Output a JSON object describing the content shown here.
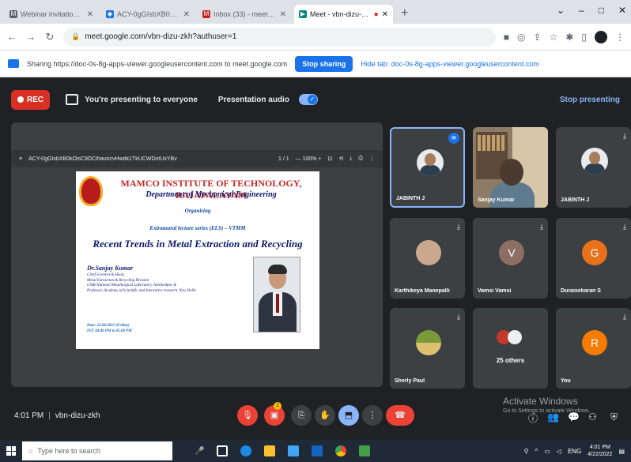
{
  "browser": {
    "tabs": [
      {
        "label": "Webinar invitation for \"Recent T...",
        "favicon_color": "#5f6368",
        "active": false
      },
      {
        "label": "ACY-0gGIsbXB0kOlsC9DCI...",
        "favicon_color": "#1a73e8",
        "active": false
      },
      {
        "label": "Inbox (33) - meetsangita@rdtp...",
        "favicon_color": "#c5221f",
        "active": false
      },
      {
        "label": "Meet - vbn-dizu-zkh",
        "favicon_color": "#00897b",
        "active": true
      }
    ],
    "new_tab": "+",
    "window_controls": [
      "⌄",
      "–",
      "□",
      "✕"
    ],
    "url": "meet.google.com/vbn-dizu-zkh?authuser=1"
  },
  "sharing_bar": {
    "message": "Sharing https://doc-0s-8g-apps-viewer.googleusercontent.com to meet.google.com",
    "stop_label": "Stop sharing",
    "hide_label": "Hide tab: doc-0s-8g-apps-viewer.googleusercontent.com"
  },
  "meet_bar": {
    "rec_label": "REC",
    "presenting_text": "You're presenting to everyone",
    "audio_label": "Presentation audio",
    "stop_presenting": "Stop presenting"
  },
  "pdf_viewer": {
    "filename": "ACY-0gGIsbXB0kOlsC9DCIhauncvHwdk1TkUCWDotUxYBv",
    "page_info": "1 / 1",
    "zoom": "— 100% +"
  },
  "slide": {
    "institute": "MAMCO INSTITUTE OF TECHNOLOGY, RAJAPALAYAM",
    "department": "Department of Mechanical Engineering",
    "organizing": "Organizing",
    "series": "Extramural lecture series (ELS) – VTMM",
    "topic": "Recent Trends in Metal Extraction and Recycling",
    "speaker": "Dr.Sanjay Kumar",
    "designation": [
      "Chief Scientist & Head,",
      "Metal Extraction & Recycling Division",
      "CSIR-National Metallurgical Laboratory Jamshedpur &",
      "Professor, Academy of Scientific and Innovative research, New Delhi"
    ],
    "date": "Date: 22.04.2022 (Friday)",
    "time": "IST: 04.00 PM to 05.00 PM"
  },
  "participants": [
    {
      "name": "JABINTH J",
      "type": "photo",
      "highlight": true,
      "speaking": true
    },
    {
      "name": "Sanjay Kumar",
      "type": "video",
      "highlight": false,
      "speaking": false
    },
    {
      "name": "JABINTH J",
      "type": "photo",
      "highlight": false,
      "speaking": false
    },
    {
      "name": "Karthikeya Manepalli",
      "type": "photo2",
      "highlight": false,
      "speaking": false
    },
    {
      "name": "Vamsi Vamsi",
      "type": "letter",
      "letter": "V",
      "color": "#8d6e63",
      "highlight": false,
      "speaking": false
    },
    {
      "name": "Duraisekaran S",
      "type": "letter",
      "letter": "G",
      "color": "#e8711a",
      "highlight": false,
      "speaking": false
    },
    {
      "name": "Sherly Paul",
      "type": "photo3",
      "highlight": false,
      "speaking": false
    },
    {
      "name": "25 others",
      "type": "others",
      "highlight": false,
      "speaking": false
    },
    {
      "name": "You",
      "type": "letter",
      "letter": "R",
      "color": "#f57c00",
      "highlight": false,
      "speaking": false
    }
  ],
  "bottom": {
    "time": "4:01 PM",
    "meeting_code": "vbn-dizu-zkh",
    "activate_title": "Activate Windows",
    "activate_sub": "Go to Settings to activate Windows.",
    "badge_count": "1"
  },
  "taskbar": {
    "search_placeholder": "Type here to search",
    "lang": "ENG",
    "clock_time": "4:01 PM",
    "clock_date": "4/22/2022"
  },
  "colors": {
    "meet_bg": "#202124",
    "tile_bg": "#3c4043",
    "accent_blue": "#1a73e8",
    "danger_red": "#ea4335"
  }
}
